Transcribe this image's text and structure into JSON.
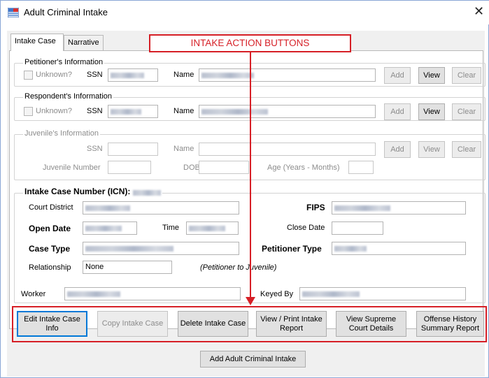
{
  "window": {
    "title": "Adult Criminal Intake",
    "app_icon": "form-icon",
    "close_glyph": "✕"
  },
  "tabs": [
    {
      "label": "Intake Case"
    },
    {
      "label": "Narrative"
    }
  ],
  "callout": {
    "text": "INTAKE ACTION BUTTONS"
  },
  "petitioner": {
    "title": "Petitioner's Information",
    "unknown_label": "Unknown?",
    "ssn_label": "SSN",
    "name_label": "Name",
    "buttons": {
      "add": "Add",
      "view": "View",
      "clear": "Clear"
    }
  },
  "respondent": {
    "title": "Respondent's Information",
    "unknown_label": "Unknown?",
    "ssn_label": "SSN",
    "name_label": "Name",
    "buttons": {
      "add": "Add",
      "view": "View",
      "clear": "Clear"
    }
  },
  "juvenile": {
    "title": "Juvenile's Information",
    "ssn_label": "SSN",
    "name_label": "Name",
    "juvenile_number_label": "Juvenile Number",
    "dob_label": "DOB",
    "age_label": "Age (Years - Months)",
    "buttons": {
      "add": "Add",
      "view": "View",
      "clear": "Clear"
    }
  },
  "intake": {
    "icn_label": "Intake Case Number (ICN):",
    "court_district_label": "Court District",
    "fips_label": "FIPS",
    "open_date_label": "Open Date",
    "time_label": "Time",
    "close_date_label": "Close Date",
    "case_type_label": "Case Type",
    "petitioner_type_label": "Petitioner Type",
    "relationship_label": "Relationship",
    "relationship_value": "None",
    "relationship_note": "(Petitioner to Juvenile)",
    "worker_label": "Worker",
    "keyed_by_label": "Keyed By"
  },
  "actions": [
    {
      "label": "Edit Intake Case Info",
      "enabled": true,
      "focused": true
    },
    {
      "label": "Copy Intake Case",
      "enabled": false
    },
    {
      "label": "Delete Intake Case",
      "enabled": true
    },
    {
      "label": "View / Print Intake Report",
      "enabled": true
    },
    {
      "label": "View Supreme Court Details",
      "enabled": true
    },
    {
      "label": "Offense History Summary Report",
      "enabled": true
    }
  ],
  "bottom_button": {
    "label": "Add Adult Criminal Intake"
  },
  "colors": {
    "callout_red": "#d61f26",
    "focus_blue": "#0078d7"
  }
}
